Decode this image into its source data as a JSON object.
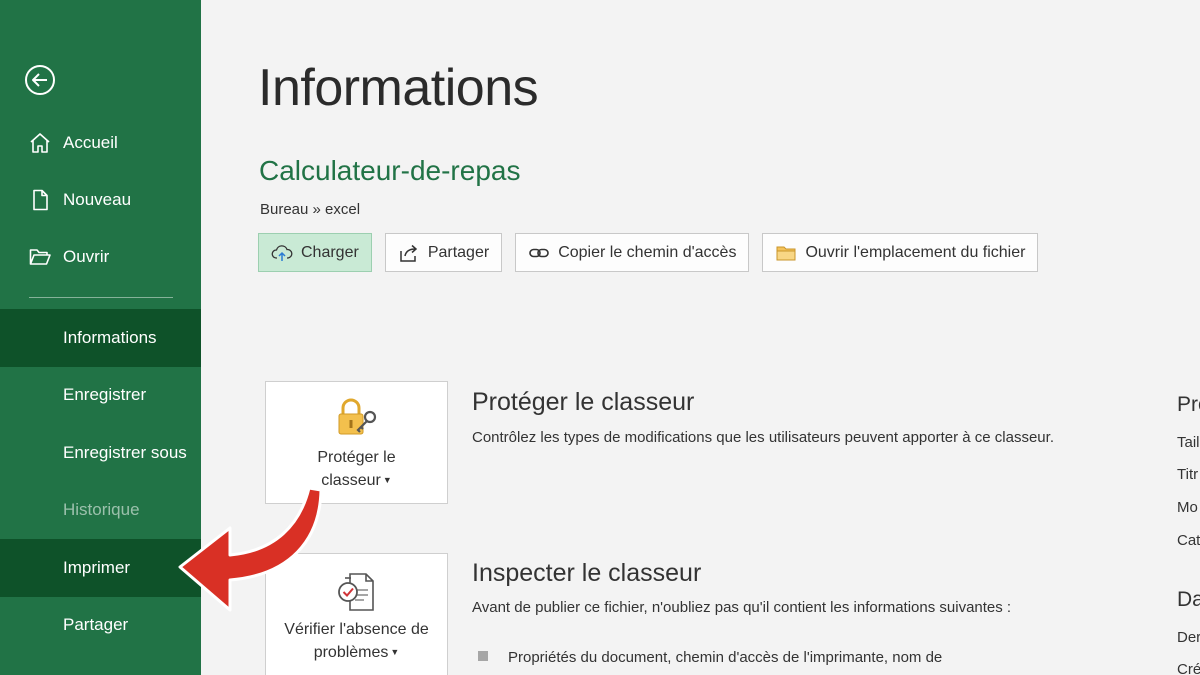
{
  "sidebar": {
    "top_items": [
      {
        "label": "Accueil",
        "icon": "home-icon"
      },
      {
        "label": "Nouveau",
        "icon": "new-document-icon"
      },
      {
        "label": "Ouvrir",
        "icon": "open-folder-icon"
      }
    ],
    "items": [
      {
        "label": "Informations",
        "state": "active"
      },
      {
        "label": "Enregistrer",
        "state": "normal"
      },
      {
        "label": "Enregistrer sous",
        "state": "normal"
      },
      {
        "label": "Historique",
        "state": "disabled"
      },
      {
        "label": "Imprimer",
        "state": "highlighted"
      },
      {
        "label": "Partager",
        "state": "normal"
      }
    ]
  },
  "main": {
    "title": "Informations",
    "document_name": "Calculateur-de-repas",
    "breadcrumb": "Bureau » excel",
    "toolbar": [
      {
        "label": "Charger",
        "icon": "cloud-upload-icon"
      },
      {
        "label": "Partager",
        "icon": "share-icon"
      },
      {
        "label": "Copier le chemin d'accès",
        "icon": "link-icon"
      },
      {
        "label": "Ouvrir l'emplacement du fichier",
        "icon": "folder-icon"
      }
    ],
    "protect": {
      "button_label": "Protéger le classeur",
      "title": "Protéger le classeur",
      "description": "Contrôlez les types de modifications que les utilisateurs peuvent apporter à ce classeur."
    },
    "inspect": {
      "button_label": "Vérifier l'absence de problèmes",
      "title": "Inspecter le classeur",
      "description": "Avant de publier ce fichier, n'oubliez pas qu'il contient les informations suivantes :",
      "bullet": "Propriétés du document, chemin d'accès de l'imprimante, nom de"
    },
    "right_column": {
      "heading1": "Pro",
      "items": [
        "Tail",
        "Titr",
        "Mo",
        "Cat"
      ],
      "heading2": "Da",
      "items2": [
        "Der",
        "Cré"
      ]
    }
  },
  "colors": {
    "sidebar": "#217346",
    "sidebar_active": "#0e5229",
    "accent_green": "#217346",
    "arrow_red": "#d93025"
  }
}
